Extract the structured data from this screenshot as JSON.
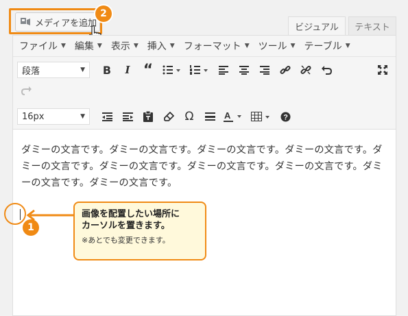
{
  "media_button": {
    "label": "メディアを追加",
    "icon": "media-camera-icon"
  },
  "tabs": [
    {
      "label": "ビジュアル",
      "active": true
    },
    {
      "label": "テキスト",
      "active": false
    }
  ],
  "menubar": {
    "items": [
      {
        "label": "ファイル"
      },
      {
        "label": "編集"
      },
      {
        "label": "表示"
      },
      {
        "label": "挿入"
      },
      {
        "label": "フォーマット"
      },
      {
        "label": "ツール"
      },
      {
        "label": "テーブル"
      }
    ]
  },
  "toolbar": {
    "format_select": "段落",
    "fontsize_select": "16px",
    "icons_row1": [
      "bold-icon",
      "italic-icon",
      "blockquote-icon",
      "bullet-list-icon",
      "numbered-list-icon",
      "align-left-icon",
      "align-center-icon",
      "align-right-icon",
      "link-icon",
      "unlink-icon",
      "undo-icon",
      "fullscreen-icon",
      "redo-icon"
    ],
    "icons_row2": [
      "outdent-icon",
      "indent-icon",
      "paste-as-text-icon",
      "clear-formatting-icon",
      "special-character-icon",
      "horizontal-line-icon",
      "text-color-icon",
      "table-icon",
      "help-icon"
    ]
  },
  "content": {
    "paragraph": "ダミーの文言です。ダミーの文言です。ダミーの文言です。ダミーの文言です。ダミーの文言です。ダミーの文言です。ダミーの文言です。ダミーの文言です。ダミーの文言です。ダミーの文言です。"
  },
  "annotations": {
    "badge1": "1",
    "badge2": "2",
    "callout_line1": "画像を配置したい場所に",
    "callout_line2": "カーソルを置きます。",
    "callout_note": "※あとでも変更できます。",
    "accent_color": "#f08a14"
  }
}
